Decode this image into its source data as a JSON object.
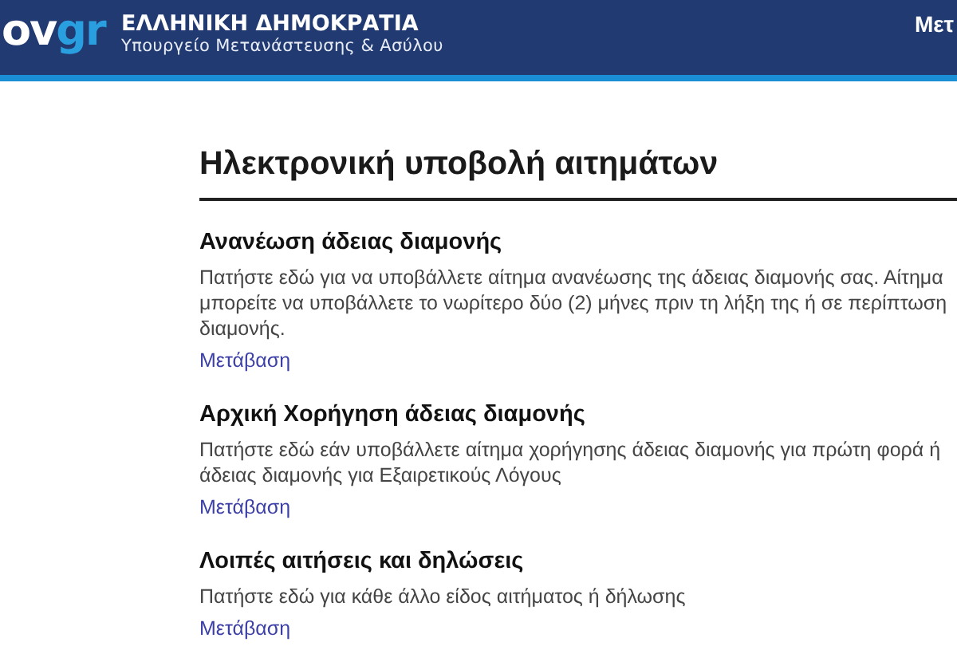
{
  "header": {
    "logo": {
      "main": "ov",
      "accent": "gr"
    },
    "title": "ΕΛΛΗΝΙΚΗ ΔΗΜΟΚΡΑΤΙΑ",
    "subtitle": "Υπουργείο Μετανάστευσης & Ασύλου",
    "menu_item": "Μετ"
  },
  "page_title": "Ηλεκτρονική υποβολή αιτημάτων",
  "sections": [
    {
      "title": "Ανανέωση άδειας διαμονής",
      "lines": [
        "Πατήστε εδώ για να υποβάλλετε αίτημα ανανέωσης της άδειας διαμονής σας. Αίτημα",
        "μπορείτε να υποβάλλετε το νωρίτερο δύο (2) μήνες πριν τη λήξη της ή σε περίπτωση",
        "διαμονής."
      ],
      "link": "Μετάβαση"
    },
    {
      "title": "Αρχική Χορήγηση άδειας διαμονής",
      "lines": [
        "Πατήστε εδώ εάν υποβάλλετε αίτημα χορήγησης άδειας διαμονής για πρώτη φορά ή",
        "άδειας διαμονής για Εξαιρετικούς Λόγους"
      ],
      "link": "Μετάβαση"
    },
    {
      "title": "Λοιπές αιτήσεις και δηλώσεις",
      "lines": [
        "Πατήστε εδώ για κάθε άλλο είδος αιτήματος ή δήλωσης"
      ],
      "link": "Μετάβαση"
    }
  ]
}
